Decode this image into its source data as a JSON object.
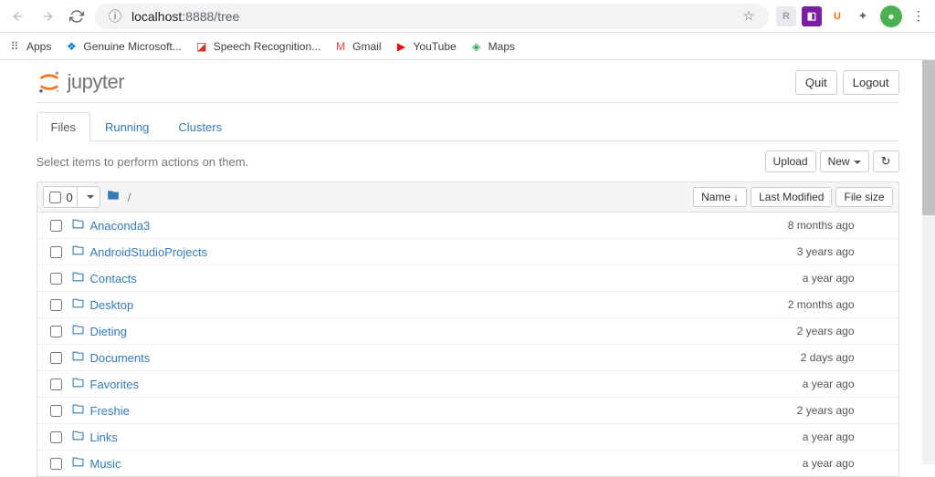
{
  "browser": {
    "url_host": "localhost",
    "url_port_path": ":8888/tree",
    "star": "☆"
  },
  "extensions": [
    {
      "bg": "#e8eaed",
      "fg": "#9aa0a6",
      "label": "R"
    },
    {
      "bg": "#7b1fa2",
      "fg": "#fff",
      "label": "◧"
    },
    {
      "bg": "#fff",
      "fg": "#ff6d00",
      "label": "U"
    },
    {
      "bg": "transparent",
      "fg": "#5f6368",
      "label": "✦"
    }
  ],
  "bookmarks": [
    {
      "icon": "⠿",
      "icon_color": "#5f6368",
      "label": "Apps"
    },
    {
      "icon": "❖",
      "icon_color": "#0078d4",
      "label": "Genuine Microsoft..."
    },
    {
      "icon": "◪",
      "icon_color": "#d93025",
      "label": "Speech Recognition..."
    },
    {
      "icon": "M",
      "icon_color": "#ea4335",
      "label": "Gmail"
    },
    {
      "icon": "▶",
      "icon_color": "#ff0000",
      "label": "YouTube"
    },
    {
      "icon": "◈",
      "icon_color": "#34a853",
      "label": "Maps"
    }
  ],
  "header": {
    "logo_text": "jupyter",
    "quit": "Quit",
    "logout": "Logout"
  },
  "tabs": [
    {
      "label": "Files",
      "active": true
    },
    {
      "label": "Running",
      "active": false
    },
    {
      "label": "Clusters",
      "active": false
    }
  ],
  "toolbar": {
    "hint": "Select items to perform actions on them.",
    "upload": "Upload",
    "new": "New",
    "selected_count": "0"
  },
  "columns": {
    "name": "Name",
    "modified": "Last Modified",
    "size": "File size"
  },
  "files": [
    {
      "name": "Anaconda3",
      "modified": "8 months ago"
    },
    {
      "name": "AndroidStudioProjects",
      "modified": "3 years ago"
    },
    {
      "name": "Contacts",
      "modified": "a year ago"
    },
    {
      "name": "Desktop",
      "modified": "2 months ago"
    },
    {
      "name": "Dieting",
      "modified": "2 years ago"
    },
    {
      "name": "Documents",
      "modified": "2 days ago"
    },
    {
      "name": "Favorites",
      "modified": "a year ago"
    },
    {
      "name": "Freshie",
      "modified": "2 years ago"
    },
    {
      "name": "Links",
      "modified": "a year ago"
    },
    {
      "name": "Music",
      "modified": "a year ago"
    }
  ]
}
